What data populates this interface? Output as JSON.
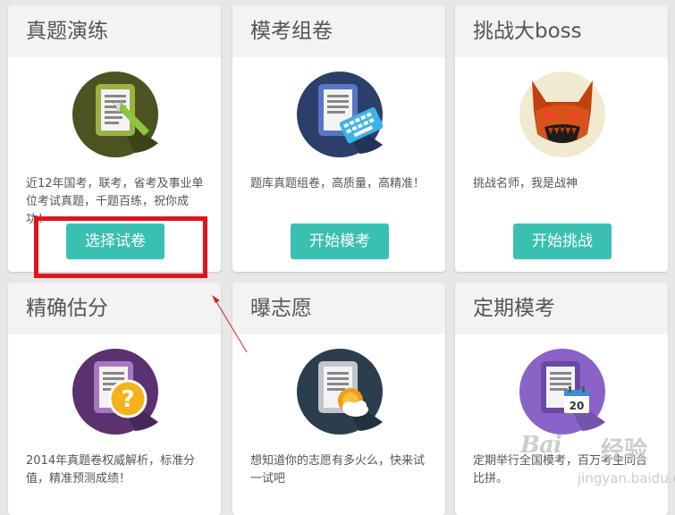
{
  "cards": [
    {
      "title": "真题演练",
      "desc": "近12年国考，联考，省考及事业单位考试真题，千题百练，祝你成功！",
      "button": "选择试卷",
      "icon": "document-pencil-icon"
    },
    {
      "title": "模考组卷",
      "desc": "题库真题组卷，高质量，高精准！",
      "button": "开始模考",
      "icon": "document-keyboard-icon"
    },
    {
      "title": "挑战大boss",
      "desc": "挑战名师，我是战神",
      "button": "开始挑战",
      "icon": "demon-boss-icon"
    },
    {
      "title": "精确估分",
      "desc": "2014年真题卷权威解析，标准分值，精准预测成绩！",
      "icon": "document-question-icon"
    },
    {
      "title": "曝志愿",
      "desc": "想知道你的志愿有多火么，快来试一试吧",
      "icon": "document-weather-icon"
    },
    {
      "title": "定期模考",
      "desc": "定期举行全国模考，百万考生同台比拼。",
      "icon": "document-calendar-icon",
      "calendar_day": "20"
    }
  ],
  "watermark": {
    "logo": "Bai",
    "text": "经验",
    "url": "jingyan.baidu.com"
  },
  "colors": {
    "accent": "#3ac0b0",
    "highlight": "#e2141b"
  }
}
